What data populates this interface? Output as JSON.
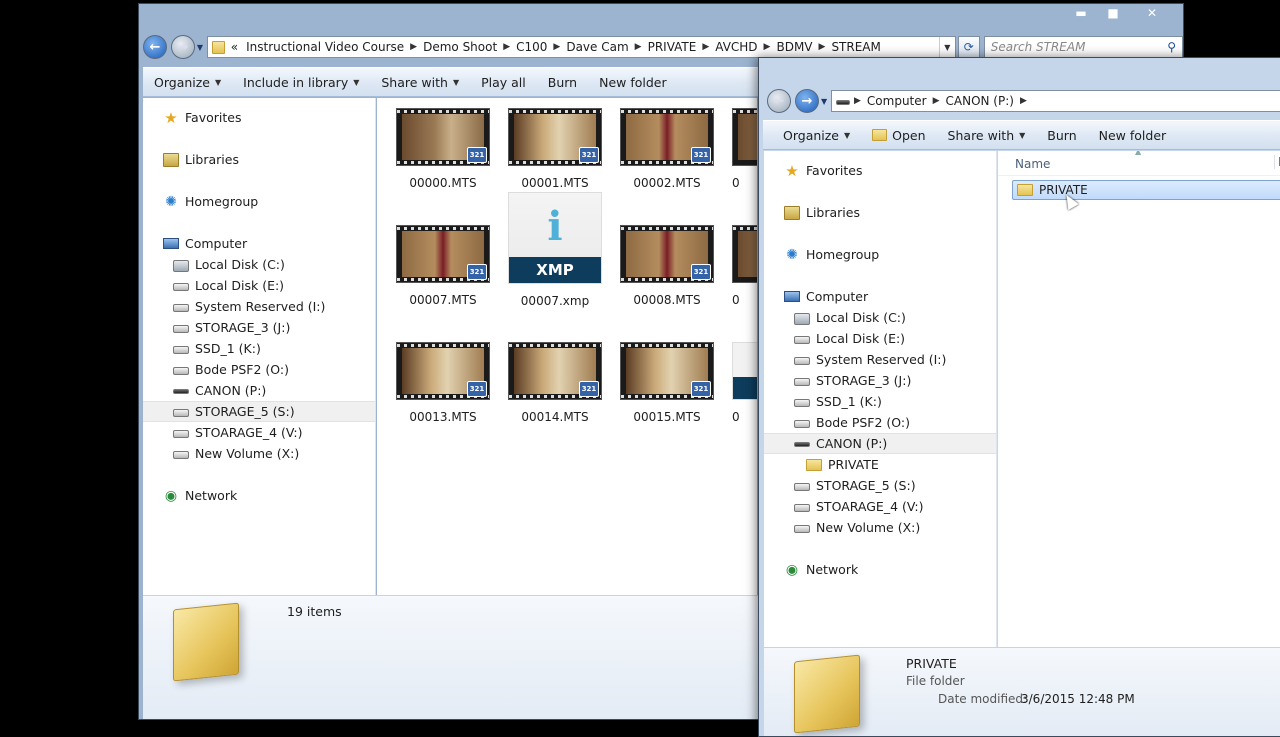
{
  "window1": {
    "caption": {
      "minimize": "▬",
      "maximize": "■",
      "close": "✕"
    },
    "address": {
      "overflow": "«",
      "crumbs": [
        "Instructional Video Course",
        "Demo Shoot",
        "C100",
        "Dave Cam",
        "PRIVATE",
        "AVCHD",
        "BDMV",
        "STREAM"
      ]
    },
    "search_placeholder": "Search STREAM",
    "toolbar": {
      "organize": "Organize",
      "include": "Include in library",
      "share": "Share with",
      "play": "Play all",
      "burn": "Burn",
      "new_folder": "New folder"
    },
    "nav": {
      "favorites": "Favorites",
      "libraries": "Libraries",
      "homegroup": "Homegroup",
      "computer": "Computer",
      "drives": [
        "Local Disk (C:)",
        "Local Disk (E:)",
        "System Reserved (I:)",
        "STORAGE_3 (J:)",
        "SSD_1 (K:)",
        "Bode PSF2 (O:)",
        "CANON (P:)",
        "STORAGE_5 (S:)",
        "STOARAGE_4 (V:)",
        "New Volume (X:)"
      ],
      "network": "Network"
    },
    "files": [
      "00000.MTS",
      "00001.MTS",
      "00002.MTS",
      "00007.MTS",
      "00007.xmp",
      "00008.MTS",
      "00013.MTS",
      "00014.MTS",
      "00015.MTS"
    ],
    "partial_labels": [
      "0",
      "0",
      "0"
    ],
    "xmp_badge": "XMP",
    "xmp_letter": "i",
    "film_badge": "321",
    "status": "19 items"
  },
  "window2": {
    "address": {
      "crumbs": [
        "Computer",
        "CANON (P:)"
      ]
    },
    "toolbar": {
      "organize": "Organize",
      "open": "Open",
      "share": "Share with",
      "burn": "Burn",
      "new_folder": "New folder"
    },
    "nav": {
      "favorites": "Favorites",
      "libraries": "Libraries",
      "homegroup": "Homegroup",
      "computer": "Computer",
      "drives": [
        "Local Disk (C:)",
        "Local Disk (E:)",
        "System Reserved (I:)",
        "STORAGE_3 (J:)",
        "SSD_1 (K:)",
        "Bode PSF2 (O:)",
        "CANON (P:)"
      ],
      "subfolder": "PRIVATE",
      "drives_after": [
        "STORAGE_5 (S:)",
        "STOARAGE_4 (V:)",
        "New Volume (X:)"
      ],
      "network": "Network"
    },
    "column_name": "Name",
    "column_next": "D",
    "items": [
      "PRIVATE"
    ],
    "details": {
      "name": "PRIVATE",
      "type": "File folder",
      "modified_label": "Date modified:",
      "modified_value": "3/6/2015 12:48 PM"
    }
  },
  "colors": {
    "accent": "#3563a8",
    "selection": "#c1dbfc",
    "xmp_bar": "#0d3c5c"
  }
}
